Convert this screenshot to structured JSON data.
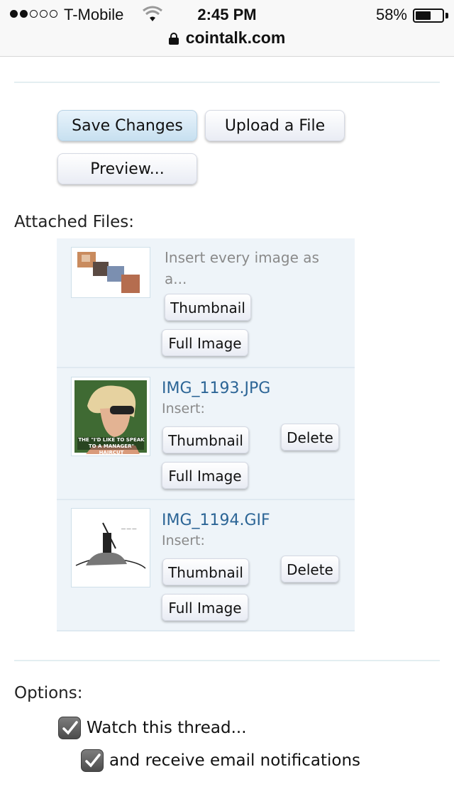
{
  "status_bar": {
    "carrier": "T-Mobile",
    "time": "2:45 PM",
    "battery_percent": "58%",
    "battery_level": 0.58,
    "signal_bars_filled": 2,
    "url": "cointalk.com",
    "icons": [
      "signal-dots-icon",
      "wifi-icon",
      "battery-icon",
      "lock-icon"
    ]
  },
  "actions": {
    "save_label": "Save Changes",
    "upload_label": "Upload a File",
    "preview_label": "Preview..."
  },
  "attachments": {
    "heading": "Attached Files:",
    "bulk": {
      "hint": "Insert every image as a...",
      "thumbnail_label": "Thumbnail",
      "full_label": "Full Image"
    },
    "files": [
      {
        "name": "IMG_1193.JPG",
        "insert_label": "Insert:",
        "thumbnail_label": "Thumbnail",
        "full_label": "Full Image",
        "delete_label": "Delete",
        "caption": "THE \"I'D LIKE TO SPEAK TO A MANAGER\" HAIRCUT"
      },
      {
        "name": "IMG_1194.GIF",
        "insert_label": "Insert:",
        "thumbnail_label": "Thumbnail",
        "full_label": "Full Image",
        "delete_label": "Delete"
      }
    ]
  },
  "options": {
    "heading": "Options:",
    "watch_label": "Watch this thread...",
    "watch_checked": true,
    "email_label": "and receive email notifications",
    "email_checked": true
  }
}
